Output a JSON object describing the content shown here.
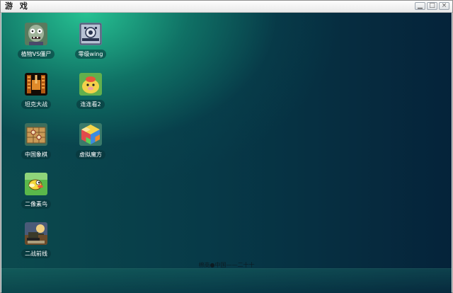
{
  "window": {
    "title": "游 戏",
    "controls": [
      "minimize-icon",
      "maximize-icon",
      "close-icon"
    ]
  },
  "desktop": {
    "icons": [
      {
        "label": "植物VS僵尸",
        "icon": "zombie-icon"
      },
      {
        "label": "零级wing",
        "icon": "spaceship-icon"
      },
      {
        "label": "坦克大战",
        "icon": "tank-icon"
      },
      {
        "label": "连连看2",
        "icon": "pig-icon"
      },
      {
        "label": "中国象棋",
        "icon": "chessboard-icon"
      },
      {
        "label": "虚拟魔方",
        "icon": "rubiks-cube-icon"
      },
      {
        "label": "二像素鸟",
        "icon": "flappy-bird-icon"
      },
      {
        "label": "二战前线",
        "icon": "war-front-icon"
      }
    ],
    "footer": "棉商●中国——二十十"
  }
}
